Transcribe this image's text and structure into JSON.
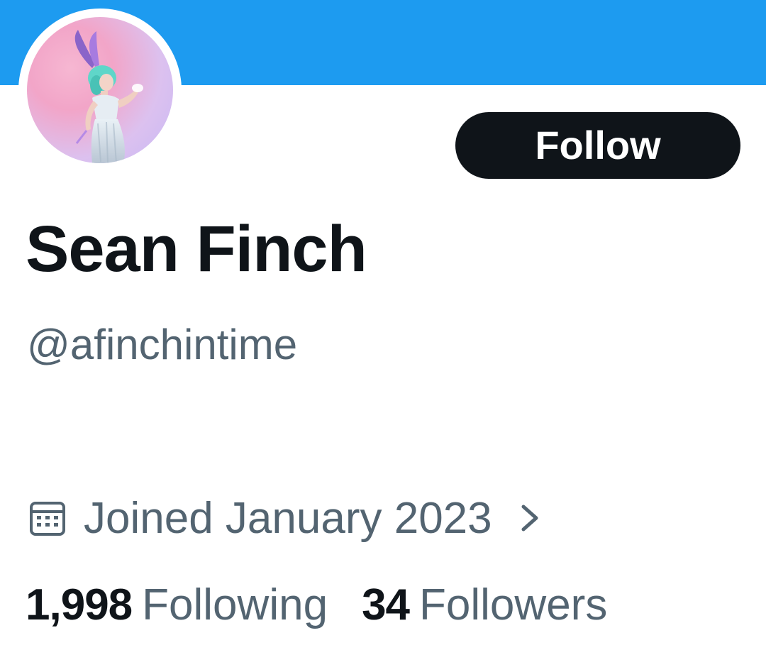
{
  "profile": {
    "display_name": "Sean Finch",
    "handle": "@afinchintime",
    "follow_label": "Follow",
    "joined": "Joined January 2023",
    "following_count": "1,998",
    "following_label": "Following",
    "followers_count": "34",
    "followers_label": "Followers"
  },
  "icons": {
    "calendar": "calendar-icon",
    "chevron": "chevron-right-icon"
  },
  "colors": {
    "banner": "#1d9bf0",
    "follow_button_bg": "#0f1419",
    "primary_text": "#0f1419",
    "secondary_text": "#536471"
  }
}
